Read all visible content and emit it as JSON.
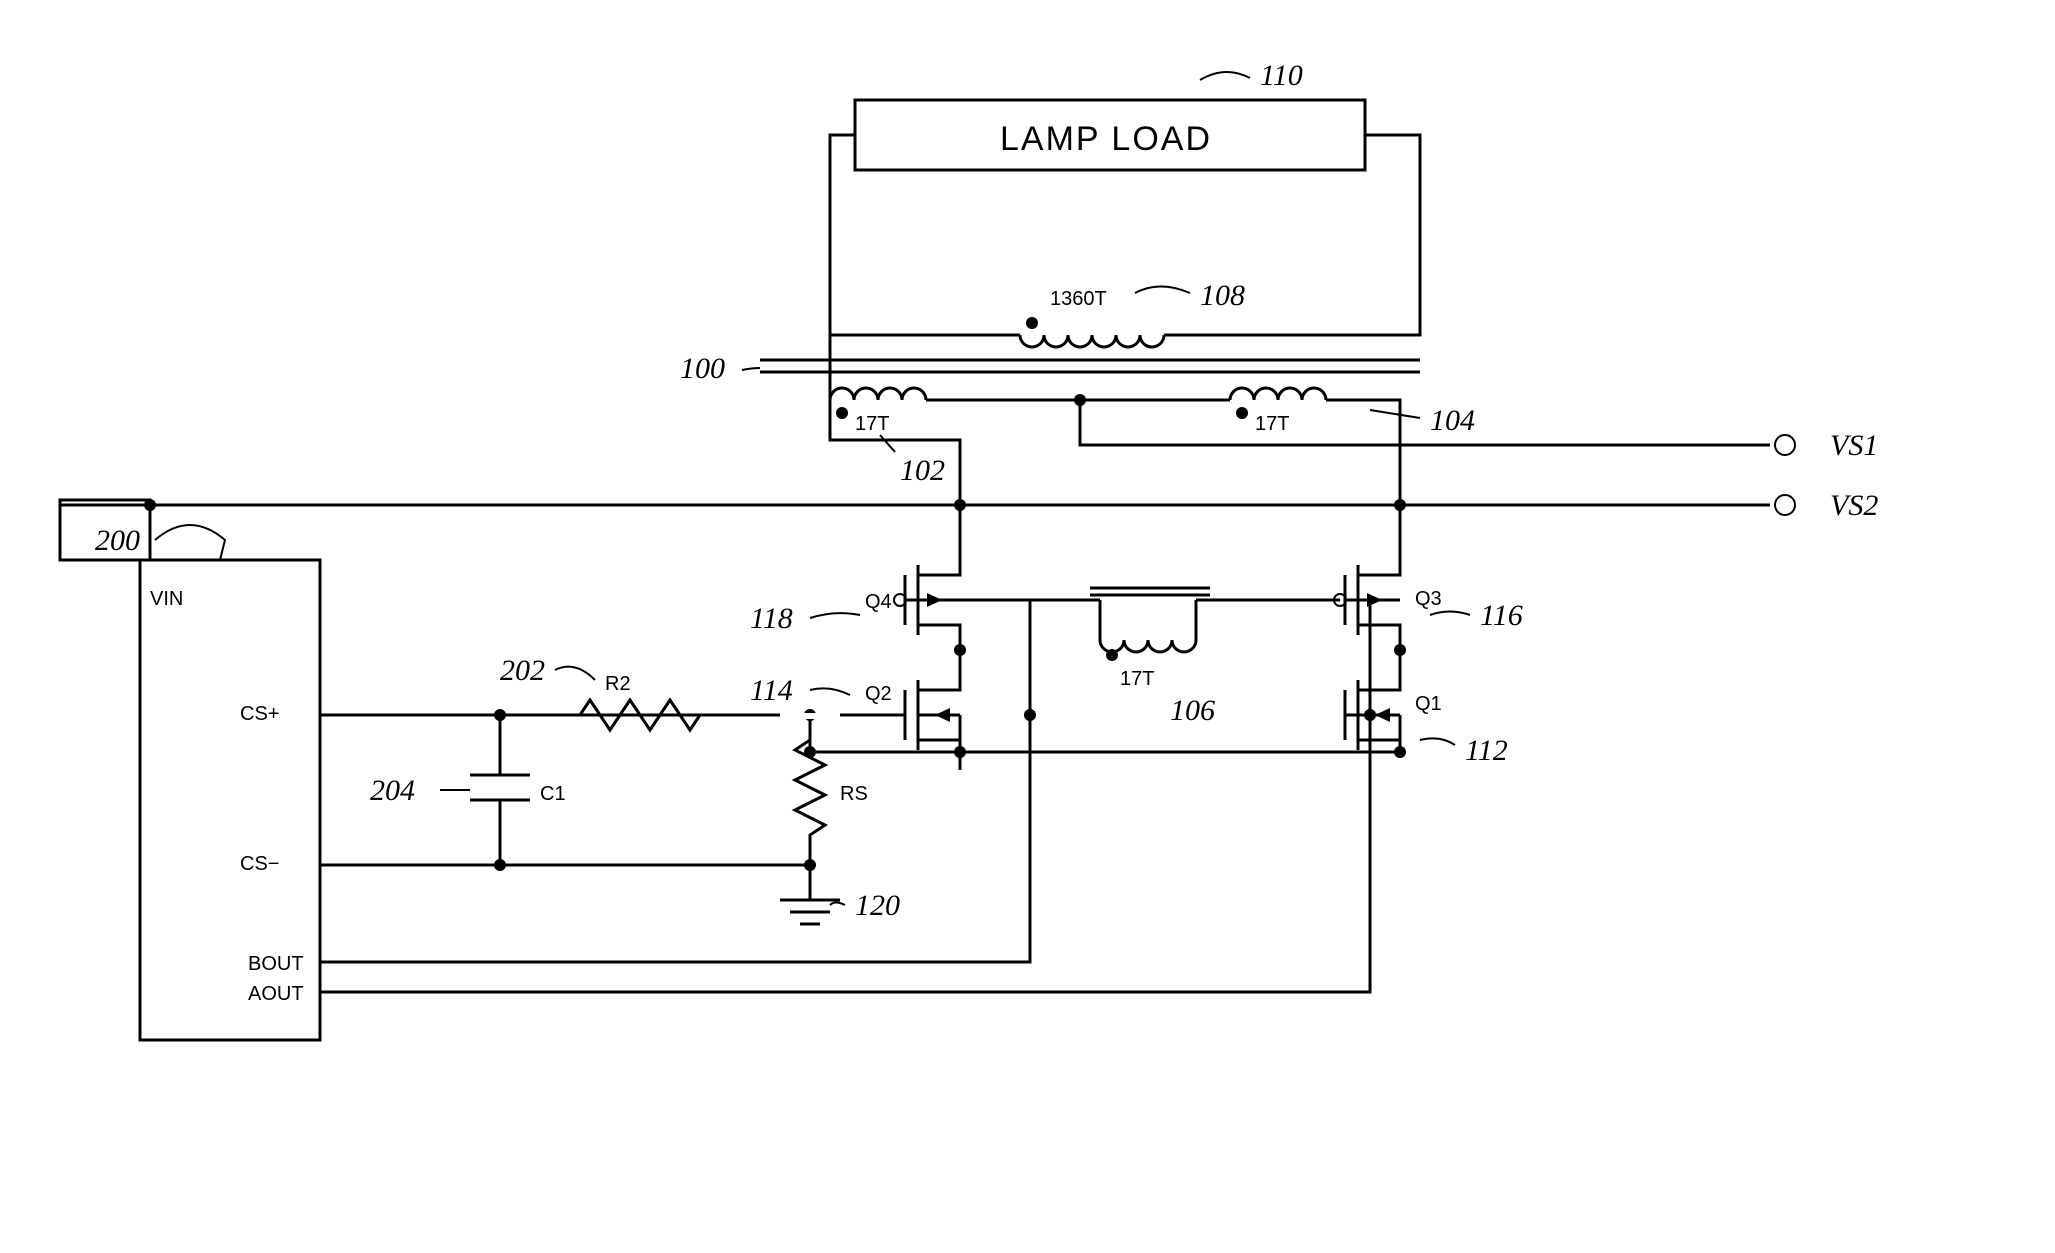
{
  "refs": {
    "r100": "100",
    "r102": "102",
    "r104": "104",
    "r106": "106",
    "r108": "108",
    "r110": "110",
    "r112": "112",
    "r114": "114",
    "r116": "116",
    "r118": "118",
    "r120": "120",
    "r200": "200",
    "r202": "202",
    "r204": "204"
  },
  "labels": {
    "lamp": "LAMP LOAD",
    "t1360": "1360T",
    "t17": "17T",
    "q1": "Q1",
    "q2": "Q2",
    "q3": "Q3",
    "q4": "Q4",
    "r2": "R2",
    "rs": "RS",
    "c1": "C1",
    "vs1": "VS1",
    "vs2": "VS2",
    "vin": "VIN",
    "csp": "CS+",
    "csm": "CS−",
    "bout": "BOUT",
    "aout": "AOUT"
  }
}
